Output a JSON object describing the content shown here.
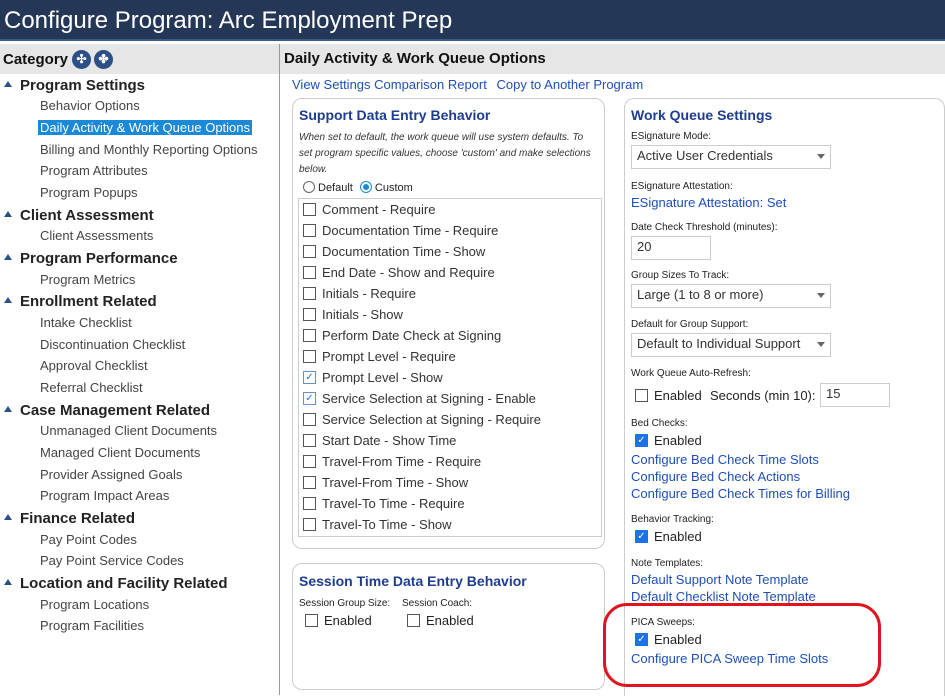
{
  "window": {
    "title": "Configure Program: Arc Employment Prep"
  },
  "category_panel": {
    "header": "Category",
    "groups": [
      {
        "label": "Program Settings",
        "items": [
          "Behavior Options",
          "Daily Activity & Work Queue Options",
          "Billing and Monthly Reporting Options",
          "Program Attributes",
          "Program Popups"
        ]
      },
      {
        "label": "Client Assessment",
        "items": [
          "Client Assessments"
        ]
      },
      {
        "label": "Program Performance",
        "items": [
          "Program Metrics"
        ]
      },
      {
        "label": "Enrollment Related",
        "items": [
          "Intake Checklist",
          "Discontinuation Checklist",
          "Approval Checklist",
          "Referral Checklist"
        ]
      },
      {
        "label": "Case Management Related",
        "items": [
          "Unmanaged Client Documents",
          "Managed Client Documents",
          "Provider Assigned Goals",
          "Program Impact Areas"
        ]
      },
      {
        "label": "Finance Related",
        "items": [
          "Pay Point Codes",
          "Pay Point Service Codes"
        ]
      },
      {
        "label": "Location and Facility Related",
        "items": [
          "Program Locations",
          "Program Facilities"
        ]
      }
    ],
    "selected": "Daily Activity & Work Queue Options"
  },
  "main": {
    "title": "Daily Activity & Work Queue Options",
    "links": [
      "View Settings Comparison Report",
      "Copy to Another Program"
    ],
    "support": {
      "title": "Support Data Entry Behavior",
      "note": "When set to default, the work queue will use system defaults. To set program specific values, choose 'custom' and make selections below.",
      "radio_default": "Default",
      "radio_custom": "Custom",
      "options": [
        {
          "label": "Comment - Require",
          "checked": false
        },
        {
          "label": "Documentation Time - Require",
          "checked": false
        },
        {
          "label": "Documentation Time - Show",
          "checked": false
        },
        {
          "label": "End Date - Show and Require",
          "checked": false
        },
        {
          "label": "Initials - Require",
          "checked": false
        },
        {
          "label": "Initials - Show",
          "checked": false
        },
        {
          "label": "Perform Date Check at Signing",
          "checked": false
        },
        {
          "label": "Prompt Level - Require",
          "checked": false
        },
        {
          "label": "Prompt Level - Show",
          "checked": true
        },
        {
          "label": "Service Selection at Signing - Enable",
          "checked": true
        },
        {
          "label": "Service Selection at Signing - Require",
          "checked": false
        },
        {
          "label": "Start Date - Show Time",
          "checked": false
        },
        {
          "label": "Travel-From Time - Require",
          "checked": false
        },
        {
          "label": "Travel-From Time - Show",
          "checked": false
        },
        {
          "label": "Travel-To Time - Require",
          "checked": false
        },
        {
          "label": "Travel-To Time - Show",
          "checked": false
        }
      ]
    },
    "session": {
      "title": "Session Time Data Entry Behavior",
      "group_size_label": "Session Group Size:",
      "coach_label": "Session Coach:",
      "enabled": "Enabled"
    },
    "work_queue": {
      "title": "Work Queue Settings",
      "esig_mode_label": "ESignature Mode:",
      "esig_mode_value": "Active User Credentials",
      "esig_attest_label": "ESignature Attestation:",
      "esig_attest_link": "ESignature Attestation: Set",
      "date_check_label": "Date Check Threshold (minutes):",
      "date_check_value": "20",
      "group_sizes_label": "Group Sizes To Track:",
      "group_sizes_value": "Large (1 to 8 or more)",
      "group_support_label": "Default for Group Support:",
      "group_support_value": "Default to Individual Support",
      "auto_refresh_label": "Work Queue Auto-Refresh:",
      "auto_refresh_enabled": "Enabled",
      "seconds_label": "Seconds (min 10):",
      "seconds_value": "15",
      "bed_checks_label": "Bed Checks:",
      "enabled": "Enabled",
      "bed_links": [
        "Configure Bed Check Time Slots",
        "Configure Bed Check Actions",
        "Configure Bed Check Times for Billing"
      ],
      "behavior_tracking_label": "Behavior Tracking:",
      "note_templates_label": "Note Templates:",
      "note_links": [
        "Default Support Note Template",
        "Default Checklist Note Template"
      ],
      "pica_label": "PICA Sweeps:",
      "pica_link": "Configure PICA Sweep Time Slots"
    }
  },
  "colors": {
    "title_bar": "#243757",
    "selected": "#1a8ad8",
    "link": "#1d4fb8",
    "heading": "#1d3d8f",
    "highlight_ring": "#e0141f"
  }
}
